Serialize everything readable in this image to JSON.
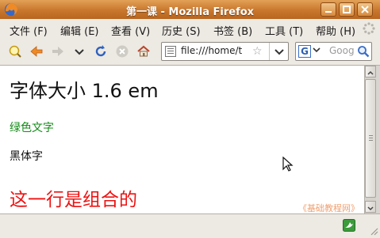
{
  "window": {
    "title": "第一课 - Mozilla Firefox"
  },
  "menubar": {
    "items": [
      {
        "label": "文件 (F)"
      },
      {
        "label": "编辑 (E)"
      },
      {
        "label": "查看 (V)"
      },
      {
        "label": "历史 (S)"
      },
      {
        "label": "书签 (B)"
      },
      {
        "label": "工具 (T)"
      },
      {
        "label": "帮助 (H)"
      }
    ]
  },
  "navbar": {
    "url": "file:///home/t",
    "search_placeholder": "Goog"
  },
  "page": {
    "heading": "字体大小 1.6 em",
    "green_text": "绿色文字",
    "bold_text": "黑体字",
    "red_text": "这一行是组合的",
    "watermark": "《基础教程网》"
  },
  "colors": {
    "titlebar": "#c8772d",
    "green_text": "#118c16",
    "red_text": "#ee1111",
    "watermark": "#f0a070"
  }
}
